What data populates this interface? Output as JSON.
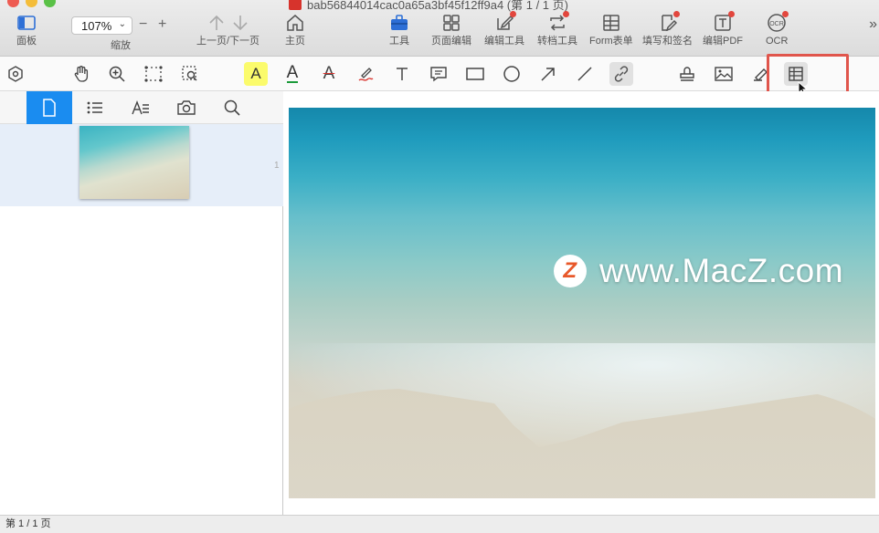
{
  "window": {
    "title": "bab56844014cac0a65a3bf45f12ff9a4 (第 1 / 1 页)"
  },
  "toolbar": {
    "panel_label": "面板",
    "zoom_value": "107%",
    "zoom_label": "缩放",
    "zoom_minus": "−",
    "zoom_plus": "+",
    "prev_next_label": "上一页/下一页",
    "home_label": "主页",
    "tools_label": "工具",
    "page_edit_label": "页面编辑",
    "edit_tools_label": "编辑工具",
    "convert_tools_label": "转档工具",
    "form_label": "Form表单",
    "fill_sign_label": "填写和签名",
    "edit_pdf_label": "编辑PDF",
    "ocr_label": "OCR",
    "more_label": "»"
  },
  "annotation_toolbar": {
    "highlight_letter": "A",
    "underline_letter": "A",
    "strike_letter": "A",
    "active_tool": "table",
    "tooltip": "表格"
  },
  "sidebar": {
    "active_tab": "pages",
    "tabs": [
      "pages",
      "outline",
      "annotations",
      "snapshot",
      "search"
    ],
    "thumbnail_page_number": "1"
  },
  "document": {
    "watermark_logo": "Z",
    "watermark_text": "www.MacZ.com"
  },
  "status": {
    "page_info": "第 1 / 1 页"
  },
  "colors": {
    "accent_blue": "#1a8cf0",
    "highlight_red": "#e0554c",
    "badge_red": "#e2463d",
    "highlight_yellow": "#fbfb6c"
  }
}
